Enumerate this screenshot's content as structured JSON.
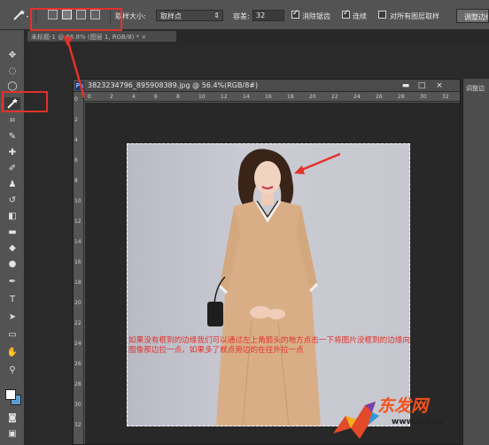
{
  "options": {
    "sample_size_label": "取样大小:",
    "sample_size_value": "取样点",
    "tolerance_label": "容差:",
    "tolerance_value": "32",
    "antialias_label": "消除锯齿",
    "contiguous_label": "连续",
    "sample_all_label": "对所有图层取样",
    "refine_label": "调整边缘"
  },
  "back_tab": {
    "title": "未标题-1 @ 66.8% (图层 1, RGB/8) * ×"
  },
  "document": {
    "title": "3823234796_895908389.jpg @ 56.4%(RGB/8#)",
    "ps_badge": "Ps",
    "close": "×",
    "ruler_top": [
      "0",
      "2",
      "4",
      "6",
      "8",
      "10",
      "12",
      "14",
      "16",
      "18",
      "20",
      "22",
      "24",
      "26",
      "28",
      "30",
      "32"
    ],
    "ruler_left": [
      "0",
      "2",
      "4",
      "6",
      "8",
      "10",
      "12",
      "14",
      "16",
      "18",
      "20",
      "22",
      "24",
      "26",
      "28",
      "30",
      "32"
    ]
  },
  "right_strip": {
    "label": "调整边"
  },
  "annotation": {
    "note": "如果没有框到的边缘我们可以通过左上角箭头的地方点击一下将图片没框到的边缘向图像那边拉一点，如果多了就点旁边的在往外拉一点"
  },
  "watermark": {
    "brand": "东发网",
    "url": "www.cpf.cn"
  },
  "colors": {
    "accent_red": "#e4312b",
    "brand_orange": "#f2531c",
    "ps_blue": "#1e3a6e",
    "dress": "#d9ae87",
    "foreground_swatch": "#ffffff",
    "background_swatch": "#5b9fd0"
  },
  "icons": [
    "magic-wand-icon",
    "move-icon",
    "marquee-icon",
    "lasso-icon",
    "crop-icon",
    "eyedropper-icon",
    "healing-icon",
    "brush-icon",
    "stamp-icon",
    "history-brush-icon",
    "eraser-icon",
    "gradient-icon",
    "blur-icon",
    "dodge-icon",
    "pen-icon",
    "type-icon",
    "path-select-icon",
    "shape-icon",
    "hand-icon",
    "zoom-icon"
  ]
}
